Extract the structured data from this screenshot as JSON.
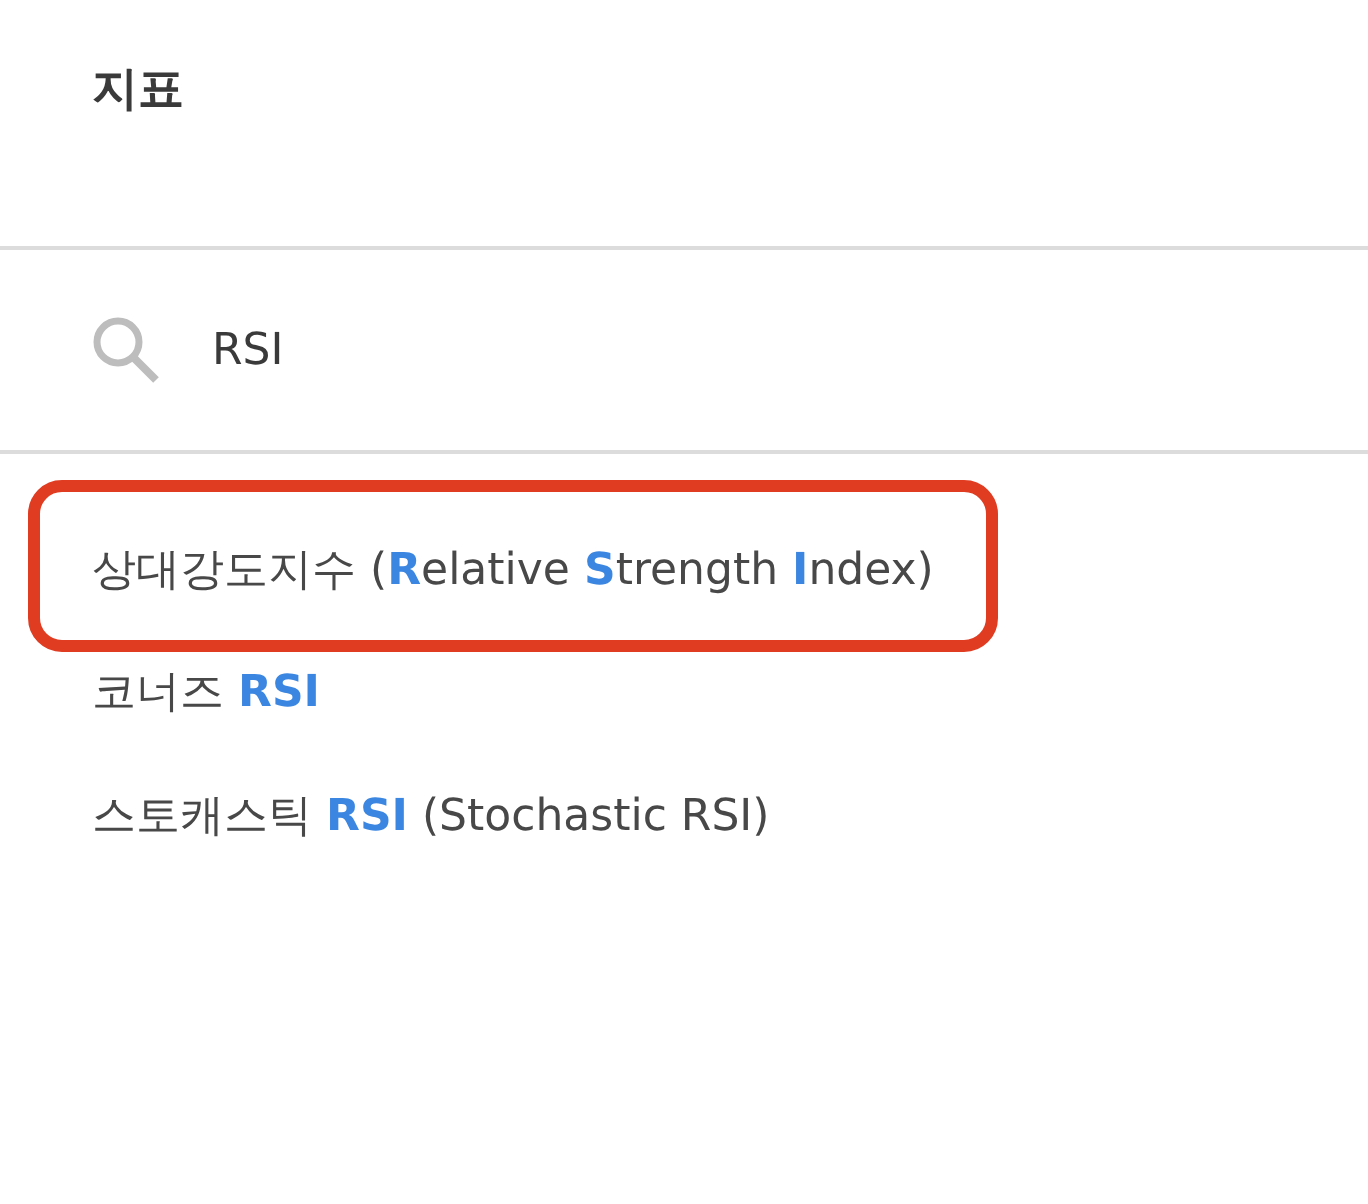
{
  "panel": {
    "title": "지표"
  },
  "search": {
    "value": "RSI"
  },
  "results": [
    {
      "label": "상대강도지수 (**R**elative **S**trength **I**ndex)",
      "highlighted": true
    },
    {
      "label": "코너즈 **RSI**",
      "highlighted": false
    },
    {
      "label": "스토캐스틱 **RSI** (Stochastic RSI)",
      "highlighted": false
    }
  ]
}
